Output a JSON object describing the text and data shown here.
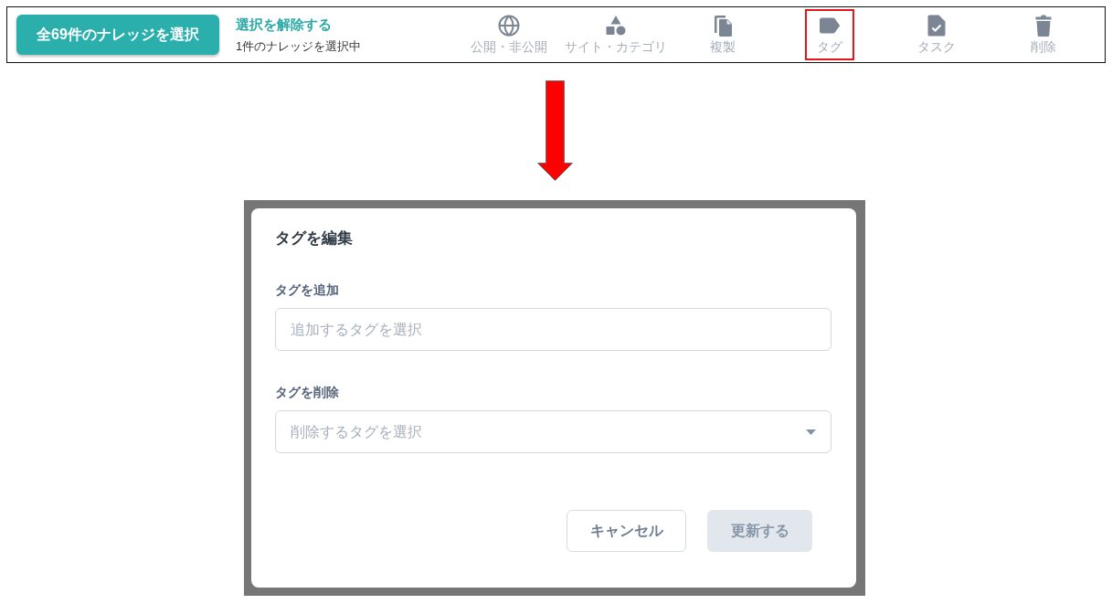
{
  "toolbar": {
    "select_all_button": "全69件のナレッジを選択",
    "deselect_link": "選択を解除する",
    "selection_count": "1件のナレッジを選択中",
    "actions": [
      {
        "kind": "globe",
        "label": "公開・非公開",
        "highlighted": false
      },
      {
        "kind": "shapes",
        "label": "サイト・カテゴリ",
        "highlighted": false
      },
      {
        "kind": "copy",
        "label": "複製",
        "highlighted": false
      },
      {
        "kind": "tag",
        "label": "タグ",
        "highlighted": true
      },
      {
        "kind": "task",
        "label": "タスク",
        "highlighted": false
      },
      {
        "kind": "trash",
        "label": "削除",
        "highlighted": false
      }
    ]
  },
  "dialog": {
    "title": "タグを編集",
    "fields": [
      {
        "kind": "input",
        "label": "タグを追加",
        "placeholder": "追加するタグを選択"
      },
      {
        "kind": "select",
        "label": "タグを削除",
        "placeholder": "削除するタグを選択"
      }
    ],
    "buttons": [
      {
        "kind": "secondary",
        "label": "キャンセル",
        "disabled": false
      },
      {
        "kind": "primary",
        "label": "更新する",
        "disabled": true
      }
    ]
  }
}
